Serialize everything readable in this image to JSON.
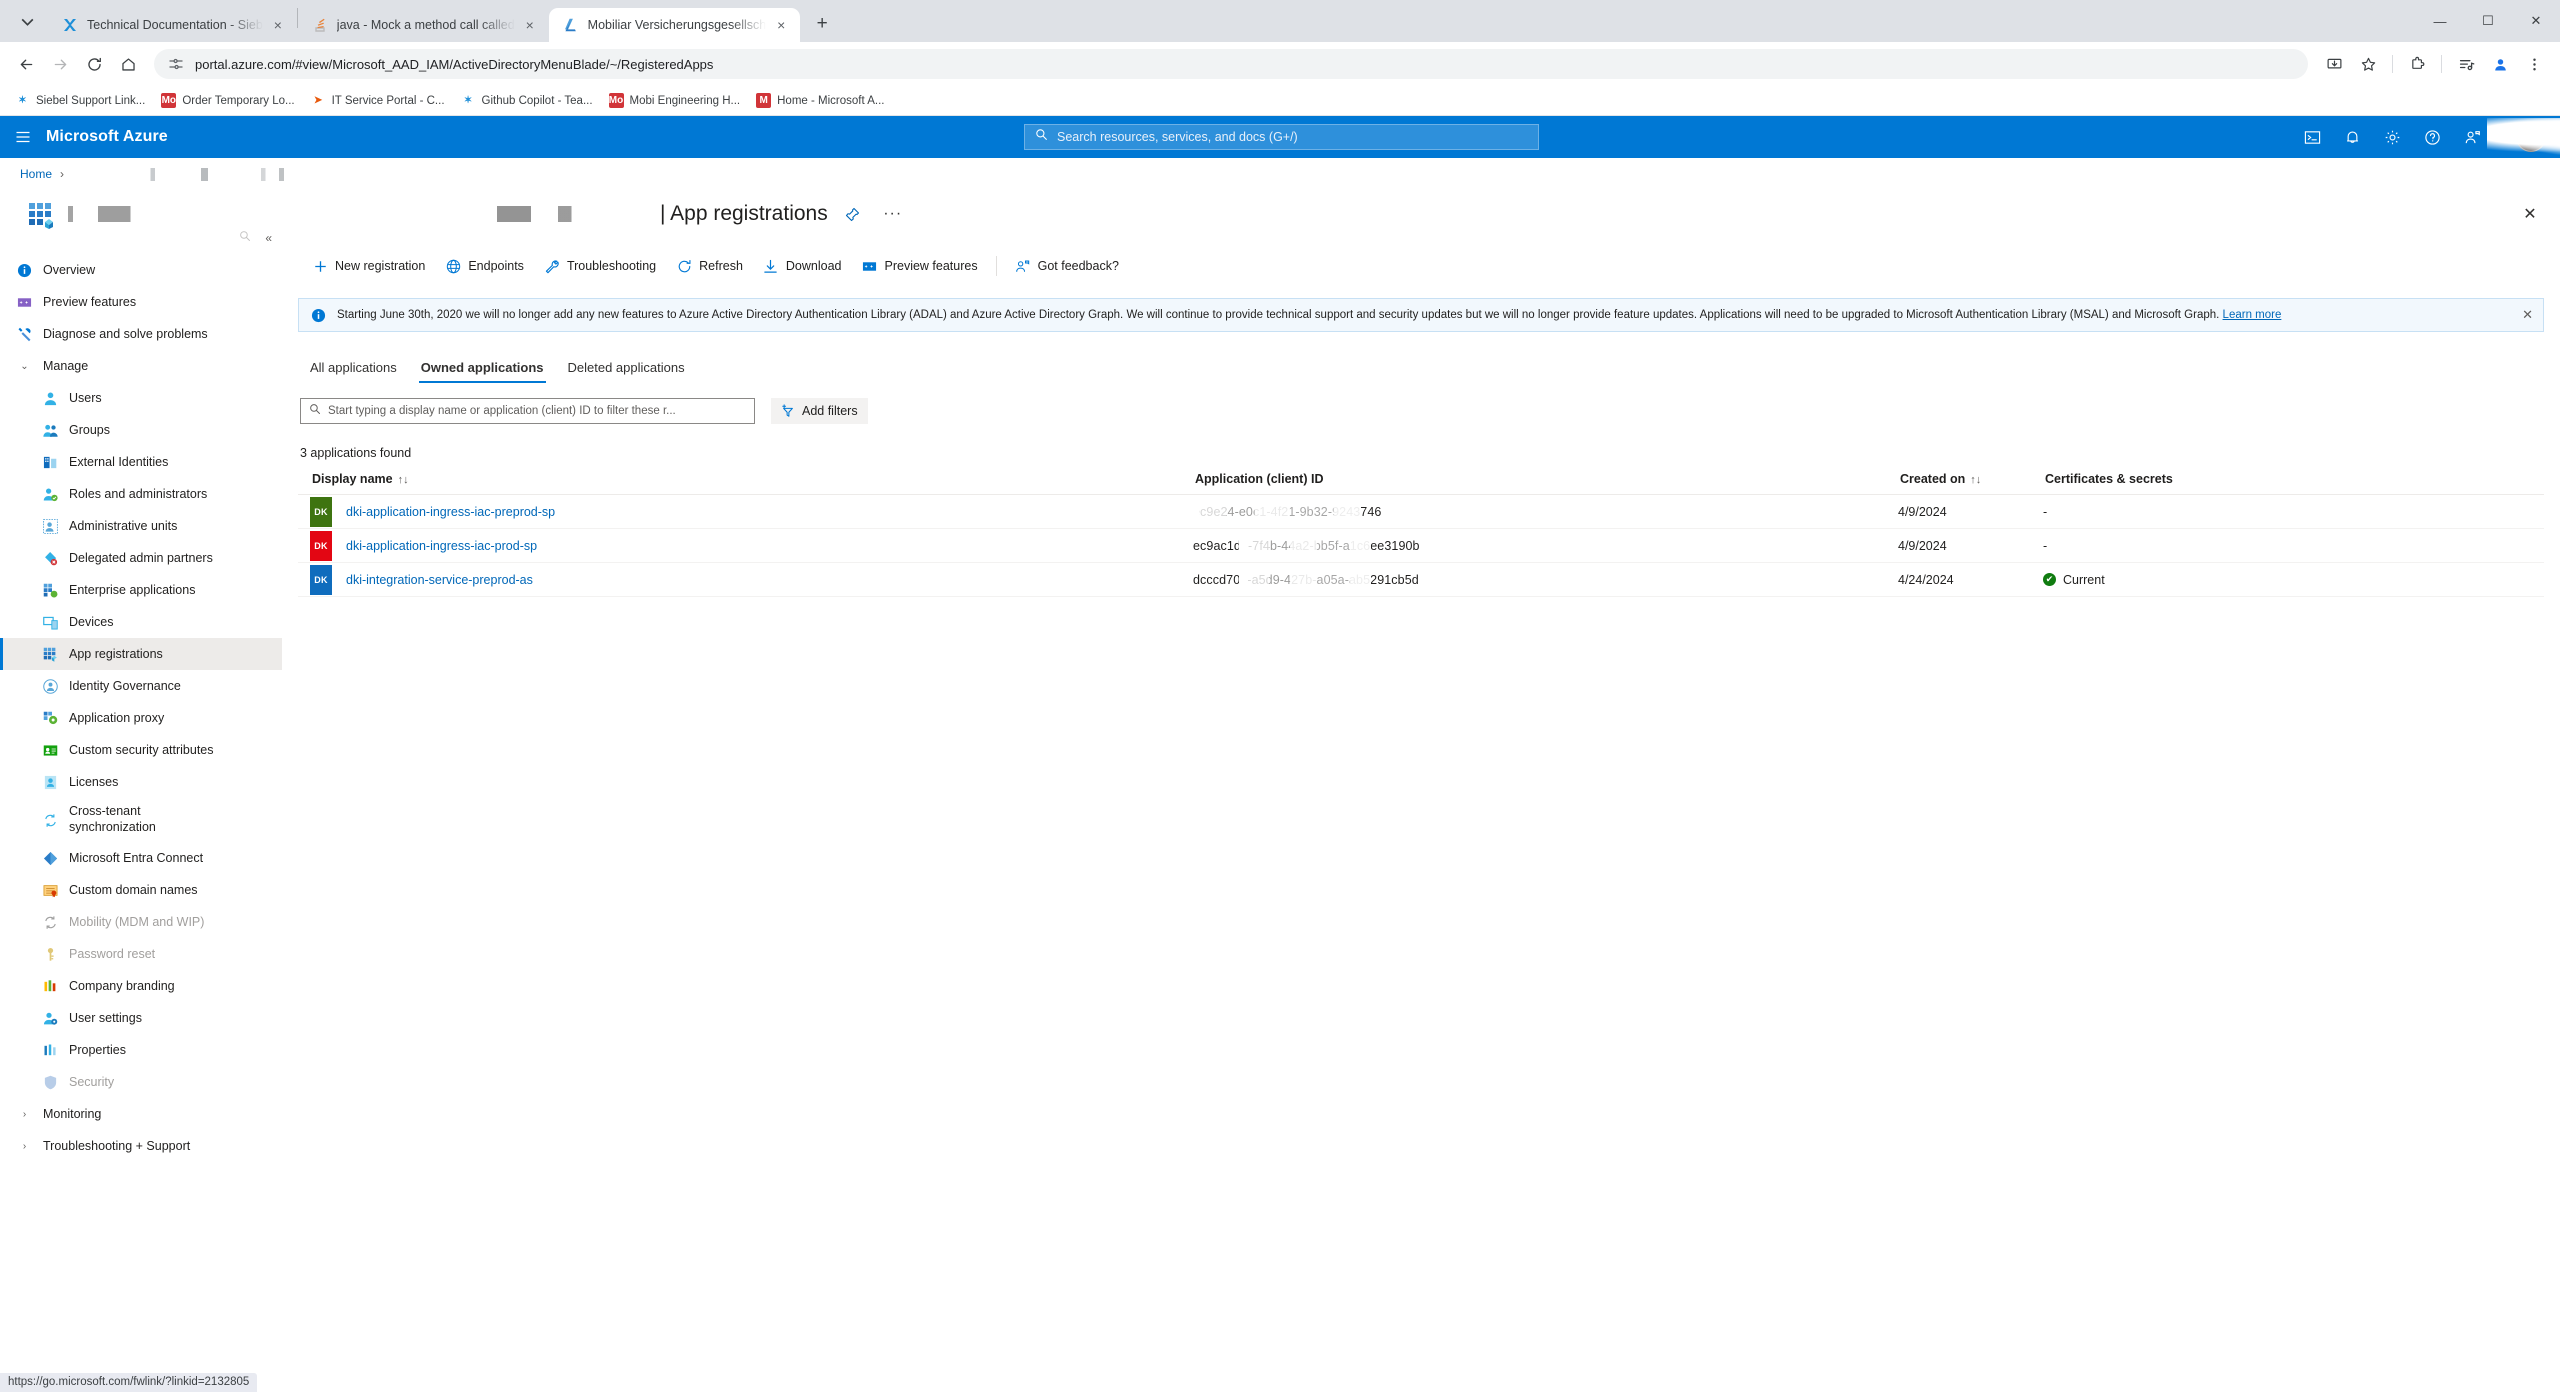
{
  "browser": {
    "tabs": [
      {
        "title": "Technical Documentation - Sieb",
        "favicon": "siebel-icon",
        "active": false
      },
      {
        "title": "java - Mock a method call called",
        "favicon": "stackoverflow-icon",
        "active": false
      },
      {
        "title": "Mobiliar Versicherungsgesellsch",
        "favicon": "azure-icon",
        "active": true
      }
    ],
    "new_tab_label": "+",
    "tab_close_label": "×",
    "window_controls": {
      "minimize": "—",
      "maximize": "☐",
      "close": "✕"
    },
    "url": "portal.azure.com/#view/Microsoft_AAD_IAM/ActiveDirectoryMenuBlade/~/RegisteredApps",
    "bookmarks": [
      {
        "label": "Siebel Support Link...",
        "icon": "siebel-icon",
        "color": "#1e8fd8",
        "glyph": "✶"
      },
      {
        "label": "Order Temporary Lo...",
        "icon": "microsoft-red-icon",
        "color": "#d13438",
        "glyph": "Mo"
      },
      {
        "label": "IT Service Portal - C...",
        "icon": "servicenow-icon",
        "color": "#e8590c",
        "glyph": "➤"
      },
      {
        "label": "Github Copilot - Tea...",
        "icon": "siebel-icon",
        "color": "#1e8fd8",
        "glyph": "✶"
      },
      {
        "label": "Mobi Engineering H...",
        "icon": "microsoft-red-icon",
        "color": "#d13438",
        "glyph": "Mo"
      },
      {
        "label": "Home - Microsoft A...",
        "icon": "microsoft-red-icon",
        "color": "#d13438",
        "glyph": "M"
      }
    ]
  },
  "azure_header": {
    "brand": "Microsoft Azure",
    "search_placeholder": "Search resources, services, and docs (G+/)",
    "icons": [
      "cloud-shell-icon",
      "notifications-icon",
      "settings-gear-icon",
      "help-question-icon",
      "feedback-smiley-icon"
    ]
  },
  "breadcrumb": {
    "home": "Home",
    "separator": "›"
  },
  "blade": {
    "title": "| App registrations",
    "pin_label": "☆",
    "more_label": "···",
    "close_label": "✕"
  },
  "sidebar": {
    "collapse_label": "«",
    "items": [
      {
        "label": "Overview",
        "icon": "info-circle-icon",
        "level": "top",
        "color": "#0078d4"
      },
      {
        "label": "Preview features",
        "icon": "preview-features-icon",
        "level": "top",
        "color": "#8661c5"
      },
      {
        "label": "Diagnose and solve problems",
        "icon": "wrench-icon",
        "level": "top",
        "color": "#0078d4"
      },
      {
        "label": "Manage",
        "icon": "chevron-down-icon",
        "level": "group"
      },
      {
        "label": "Users",
        "icon": "user-icon",
        "level": "sub",
        "color": "#32b1e5"
      },
      {
        "label": "Groups",
        "icon": "groups-icon",
        "level": "sub",
        "color": "#32b1e5"
      },
      {
        "label": "External Identities",
        "icon": "external-identities-icon",
        "level": "sub",
        "color": "#0f6cbd"
      },
      {
        "label": "Roles and administrators",
        "icon": "roles-icon",
        "level": "sub",
        "color": "#5cb335"
      },
      {
        "label": "Administrative units",
        "icon": "administrative-units-icon",
        "level": "sub",
        "color": "#59a7d8"
      },
      {
        "label": "Delegated admin partners",
        "icon": "delegated-partners-icon",
        "level": "sub",
        "color": "#32b1e5"
      },
      {
        "label": "Enterprise applications",
        "icon": "enterprise-apps-icon",
        "level": "sub",
        "color": "#0f6cbd"
      },
      {
        "label": "Devices",
        "icon": "devices-icon",
        "level": "sub",
        "color": "#32b1e5"
      },
      {
        "label": "App registrations",
        "icon": "app-registrations-icon",
        "level": "sub",
        "color": "#0f6cbd",
        "selected": true
      },
      {
        "label": "Identity Governance",
        "icon": "identity-governance-icon",
        "level": "sub",
        "color": "#59a7d8"
      },
      {
        "label": "Application proxy",
        "icon": "application-proxy-icon",
        "level": "sub",
        "color": "#5cb335"
      },
      {
        "label": "Custom security attributes",
        "icon": "custom-security-attributes-icon",
        "level": "sub",
        "color": "#13a10e"
      },
      {
        "label": "Licenses",
        "icon": "licenses-icon",
        "level": "sub",
        "color": "#32b1e5"
      },
      {
        "label": "Cross-tenant synchronization",
        "icon": "cross-tenant-sync-icon",
        "level": "sub",
        "color": "#32b1e5",
        "two_line": true
      },
      {
        "label": "Microsoft Entra Connect",
        "icon": "entra-connect-icon",
        "level": "sub",
        "color": "#0f6cbd"
      },
      {
        "label": "Custom domain names",
        "icon": "custom-domain-names-icon",
        "level": "sub",
        "color": "#d83b01"
      },
      {
        "label": "Mobility (MDM and WIP)",
        "icon": "mobility-icon",
        "level": "sub",
        "color": "#a0a0a0",
        "disabled": true
      },
      {
        "label": "Password reset",
        "icon": "key-icon",
        "level": "sub",
        "color": "#e0c878",
        "disabled": true
      },
      {
        "label": "Company branding",
        "icon": "company-branding-icon",
        "level": "sub",
        "color": "#ffb900"
      },
      {
        "label": "User settings",
        "icon": "user-settings-icon",
        "level": "sub",
        "color": "#32b1e5"
      },
      {
        "label": "Properties",
        "icon": "properties-icon",
        "level": "sub",
        "color": "#32b1e5"
      },
      {
        "label": "Security",
        "icon": "shield-icon",
        "level": "sub",
        "color": "#b8cde8",
        "disabled": true
      },
      {
        "label": "Monitoring",
        "icon": "chevron-right-icon",
        "level": "group-collapsed"
      },
      {
        "label": "Troubleshooting + Support",
        "icon": "chevron-right-icon",
        "level": "group-collapsed"
      }
    ]
  },
  "command_bar": [
    {
      "label": "New registration",
      "icon": "plus-icon"
    },
    {
      "label": "Endpoints",
      "icon": "globe-icon"
    },
    {
      "label": "Troubleshooting",
      "icon": "wrench-icon"
    },
    {
      "label": "Refresh",
      "icon": "refresh-icon"
    },
    {
      "label": "Download",
      "icon": "download-icon"
    },
    {
      "label": "Preview features",
      "icon": "preview-features-icon"
    },
    {
      "label": "Got feedback?",
      "icon": "feedback-smiley-icon",
      "after_separator": true
    }
  ],
  "banner": {
    "icon": "info-circle-icon",
    "text": "Starting June 30th, 2020 we will no longer add any new features to Azure Active Directory Authentication Library (ADAL) and Azure Active Directory Graph. We will continue to provide technical support and security updates but we will no longer provide feature updates. Applications will need to be upgraded to Microsoft Authentication Library (MSAL) and Microsoft Graph.",
    "link_label": "Learn more",
    "close_label": "✕"
  },
  "tabs": [
    {
      "label": "All applications",
      "active": false
    },
    {
      "label": "Owned applications",
      "active": true
    },
    {
      "label": "Deleted applications",
      "active": false
    }
  ],
  "filter": {
    "placeholder": "Start typing a display name or application (client) ID to filter these r...",
    "value": "",
    "add_filters_label": "Add filters",
    "search_icon": "search-icon",
    "add_filter_icon": "add-filter-icon"
  },
  "results": {
    "count_label": "3 applications found",
    "columns": [
      {
        "label": "Display name",
        "sortable": true,
        "sort_icon": "↑↓"
      },
      {
        "label": "Application (client) ID",
        "sortable": false
      },
      {
        "label": "Created on",
        "sortable": true,
        "sort_icon": "↑↓"
      },
      {
        "label": "Certificates & secrets",
        "sortable": false
      }
    ],
    "rows": [
      {
        "badge": "DK",
        "badge_color": "#3e7410",
        "display_name": "dki-application-ingress-iac-preprod-sp",
        "client_id": "ec9e24-e0c1-4f21-9b32-9243746",
        "client_id_redacted": true,
        "created_on": "4/9/2024",
        "certificates": "-",
        "certificates_status": "none"
      },
      {
        "badge": "DK",
        "badge_color": "#e30613",
        "display_name": "dki-application-ingress-iac-prod-sp",
        "client_id": "ec9ac1d2-7f4b-44a2-bb5f-a1c6ee3190b",
        "client_id_redacted": true,
        "created_on": "4/9/2024",
        "certificates": "-",
        "certificates_status": "none"
      },
      {
        "badge": "DK",
        "badge_color": "#0f6cbd",
        "display_name": "dki-integration-service-preprod-as",
        "client_id": "dcccd70b-a5d9-427b-a05a-ab5291cb5d",
        "client_id_redacted": true,
        "created_on": "4/24/2024",
        "certificates": "Current",
        "certificates_status": "current"
      }
    ]
  },
  "status_bar": {
    "url": "https://go.microsoft.com/fwlink/?linkid=2132805"
  },
  "colors": {
    "azure_blue": "#0078d4",
    "link_blue": "#0067b8",
    "banner_bg": "#f2f8fd",
    "banner_border": "#c7e0f4",
    "success_green": "#107c10",
    "selected_bg": "#edebe9"
  }
}
